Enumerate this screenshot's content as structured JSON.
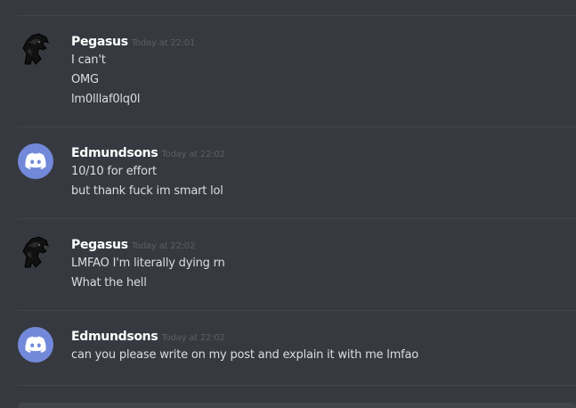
{
  "messages": [
    {
      "username": "Pegasus",
      "timestamp": "Today at 22:01",
      "avatar": "dark-horse-avatar",
      "lines": [
        "I can't",
        "OMG",
        "lm0lllaf0lq0l"
      ]
    },
    {
      "username": "Edmundsons",
      "timestamp": "Today at 22:02",
      "avatar": "discord-default-avatar",
      "lines": [
        "10/10 for effort",
        "but thank fuck im smart lol"
      ]
    },
    {
      "username": "Pegasus",
      "timestamp": "Today at 22:02",
      "avatar": "dark-horse-avatar",
      "lines": [
        "LMFAO I'm literally dying rn",
        "What the hell"
      ]
    },
    {
      "username": "Edmundsons",
      "timestamp": "Today at 22:02",
      "avatar": "discord-default-avatar",
      "lines": [
        "can you please write on my post and explain it with me lmfao"
      ]
    }
  ],
  "colors": {
    "background": "#36393f",
    "username": "#ffffff",
    "timestamp": "#5c5f65",
    "text": "#dcddde",
    "blurple": "#7289da"
  }
}
